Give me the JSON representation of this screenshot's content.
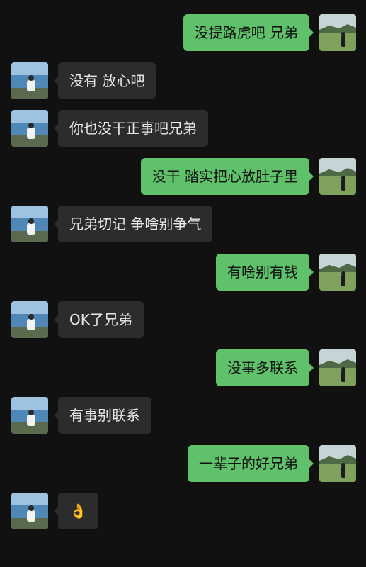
{
  "messages": [
    {
      "side": "right",
      "text": "没提路虎吧 兄弟"
    },
    {
      "side": "left",
      "text": "没有 放心吧"
    },
    {
      "side": "left",
      "text": "你也没干正事吧兄弟"
    },
    {
      "side": "right",
      "text": "没干 踏实把心放肚子里"
    },
    {
      "side": "left",
      "text": "兄弟切记 争啥别争气"
    },
    {
      "side": "right",
      "text": "有啥别有钱"
    },
    {
      "side": "left",
      "text": "OK了兄弟"
    },
    {
      "side": "right",
      "text": "没事多联系"
    },
    {
      "side": "left",
      "text": "有事别联系"
    },
    {
      "side": "right",
      "text": "一辈子的好兄弟"
    },
    {
      "side": "left",
      "text": "👌"
    }
  ],
  "colors": {
    "background": "#111111",
    "incoming_bubble": "#2c2c2c",
    "outgoing_bubble": "#5fc16a"
  }
}
